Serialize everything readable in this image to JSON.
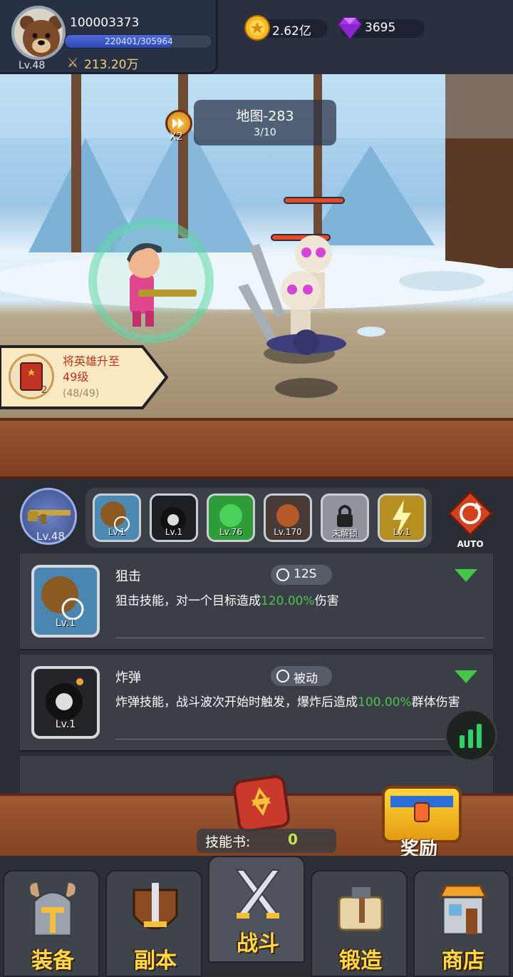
{
  "player": {
    "id": "100003373",
    "level_label": "Lv.48",
    "exp_text": "220401/305964",
    "exp_fraction": 0.72,
    "power": "213.20万"
  },
  "currency": {
    "gold": "2.62亿",
    "gems": "3695"
  },
  "battle": {
    "map_name": "地图-283",
    "wave": "3/10",
    "speed": "X2"
  },
  "quest": {
    "text": "将英雄升至49级",
    "count": "2",
    "progress": "(48/49)"
  },
  "weapon": {
    "level": "Lv.48"
  },
  "skill_slots": [
    {
      "name": "sniper-skill",
      "level": "Lv.1"
    },
    {
      "name": "bomb-skill",
      "level": "Lv.1"
    },
    {
      "name": "poison-skill",
      "level": "Lv.76"
    },
    {
      "name": "burn-skill",
      "level": "Lv.170"
    },
    {
      "name": "locked-slot",
      "level": "未解锁"
    },
    {
      "name": "lightning-skill",
      "level": "Lv.1"
    }
  ],
  "auto_label": "AUTO",
  "skills": [
    {
      "name": "狙击",
      "cooldown": "12S",
      "level": "Lv.1",
      "desc_pre": "狙击技能，对一个目标造成",
      "desc_hl": "120.00%",
      "desc_post": "伤害"
    },
    {
      "name": "炸弹",
      "cooldown": "被动",
      "level": "Lv.1",
      "desc_pre": "炸弹技能，战斗波次开始时触发，爆炸后造成",
      "desc_hl": "100.00%",
      "desc_post": "群体伤害"
    }
  ],
  "skillbook": {
    "label": "技能书:",
    "value": "0"
  },
  "reward_label": "奖励",
  "nav": {
    "equip": "装备",
    "dungeon": "副本",
    "battle": "战斗",
    "forge": "锻造",
    "shop": "商店"
  },
  "colors": {
    "accent_green": "#4ec24e",
    "nav_text": "#ffd94a"
  }
}
